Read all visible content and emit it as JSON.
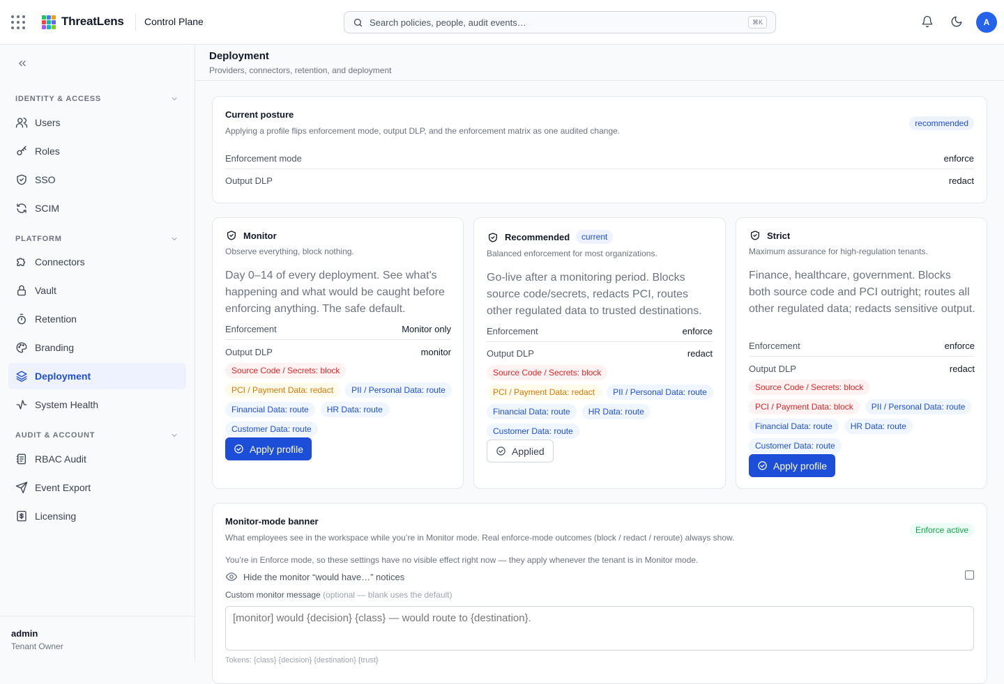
{
  "topbar": {
    "brand": "ThreatLens",
    "section": "Control Plane",
    "search_placeholder": "Search policies, people, audit events…",
    "search_shortcut": "⌘K",
    "avatar_initial": "A",
    "logo_colors": [
      "#22c55e",
      "#3b82f6",
      "#f59e0b",
      "#ef4444",
      "#14b8a6",
      "#6366f1",
      "#a855f7",
      "#06b6d4",
      "#84cc16"
    ]
  },
  "sidebar": {
    "sections": [
      {
        "title": "IDENTITY & ACCESS",
        "items": [
          {
            "label": "Users",
            "icon": "users-icon"
          },
          {
            "label": "Roles",
            "icon": "key-icon"
          },
          {
            "label": "SSO",
            "icon": "shield-icon"
          },
          {
            "label": "SCIM",
            "icon": "refresh-icon"
          }
        ]
      },
      {
        "title": "PLATFORM",
        "items": [
          {
            "label": "Connectors",
            "icon": "puzzle-icon"
          },
          {
            "label": "Vault",
            "icon": "lock-icon"
          },
          {
            "label": "Retention",
            "icon": "timer-icon"
          },
          {
            "label": "Branding",
            "icon": "palette-icon"
          },
          {
            "label": "Deployment",
            "icon": "layers-icon",
            "active": true
          },
          {
            "label": "System Health",
            "icon": "activity-icon"
          }
        ]
      },
      {
        "title": "AUDIT & ACCOUNT",
        "items": [
          {
            "label": "RBAC Audit",
            "icon": "audit-log-icon"
          },
          {
            "label": "Event Export",
            "icon": "send-icon"
          },
          {
            "label": "Licensing",
            "icon": "license-icon"
          }
        ]
      }
    ],
    "user": {
      "name": "admin",
      "role": "Tenant Owner"
    }
  },
  "page": {
    "title": "Deployment",
    "subtitle": "Providers, connectors, retention, and deployment"
  },
  "posture": {
    "title": "Current posture",
    "subtitle": "Applying a profile flips enforcement mode, output DLP, and the enforcement matrix as one audited change.",
    "badge": "recommended",
    "rows": [
      {
        "key": "Enforcement mode",
        "value": "enforce"
      },
      {
        "key": "Output DLP",
        "value": "redact"
      }
    ]
  },
  "profiles": [
    {
      "title": "Monitor",
      "badge": "",
      "subtitle": "Observe everything, block nothing.",
      "description": "Day 0–14 of every deployment. See what's happening and what would be caught before enforcing anything. The safe default.",
      "enforcement_label": "Enforcement",
      "enforcement": "Monitor only",
      "dlp_label": "Output DLP",
      "dlp": "monitor",
      "chips": [
        {
          "text": "Source Code / Secrets: block",
          "kind": "block"
        },
        {
          "text": "PCI / Payment Data: redact",
          "kind": "redact"
        },
        {
          "text": "PII / Personal Data: route",
          "kind": "route"
        },
        {
          "text": "Financial Data: route",
          "kind": "route"
        },
        {
          "text": "HR Data: route",
          "kind": "route"
        },
        {
          "text": "Customer Data: route",
          "kind": "route"
        }
      ],
      "button": "Apply profile",
      "button_kind": "primary"
    },
    {
      "title": "Recommended",
      "badge": "current",
      "subtitle": "Balanced enforcement for most organizations.",
      "description": "Go-live after a monitoring period. Blocks source code/secrets, redacts PCI, routes other regulated data to trusted destinations.",
      "enforcement_label": "Enforcement",
      "enforcement": "enforce",
      "dlp_label": "Output DLP",
      "dlp": "redact",
      "chips": [
        {
          "text": "Source Code / Secrets: block",
          "kind": "block"
        },
        {
          "text": "PCI / Payment Data: redact",
          "kind": "redact"
        },
        {
          "text": "PII / Personal Data: route",
          "kind": "route"
        },
        {
          "text": "Financial Data: route",
          "kind": "route"
        },
        {
          "text": "HR Data: route",
          "kind": "route"
        },
        {
          "text": "Customer Data: route",
          "kind": "route"
        }
      ],
      "button": "Applied",
      "button_kind": "ghost"
    },
    {
      "title": "Strict",
      "badge": "",
      "subtitle": "Maximum assurance for high-regulation tenants.",
      "description": "Finance, healthcare, government. Blocks both source code and PCI outright; routes all other regulated data; redacts sensitive output.",
      "enforcement_label": "Enforcement",
      "enforcement": "enforce",
      "dlp_label": "Output DLP",
      "dlp": "redact",
      "chips": [
        {
          "text": "Source Code / Secrets: block",
          "kind": "block"
        },
        {
          "text": "PCI / Payment Data: block",
          "kind": "block"
        },
        {
          "text": "PII / Personal Data: route",
          "kind": "route"
        },
        {
          "text": "Financial Data: route",
          "kind": "route"
        },
        {
          "text": "HR Data: route",
          "kind": "route"
        },
        {
          "text": "Customer Data: route",
          "kind": "route"
        }
      ],
      "button": "Apply profile",
      "button_kind": "primary"
    }
  ],
  "banner": {
    "title": "Monitor-mode banner",
    "subtitle": "What employees see in the workspace while you’re in Monitor mode. Real enforce-mode outcomes (block / redact / reroute) always show.",
    "badge": "Enforce active",
    "note": "You’re in Enforce mode, so these settings have no visible effect right now — they apply whenever the tenant is in Monitor mode.",
    "hide_label": "Hide the monitor “would have…” notices",
    "hide_checked": false,
    "message_label": "Custom monitor message",
    "message_hint": "(optional — blank uses the default)",
    "message_placeholder": "[monitor] would {decision} {class} — would route to {destination}.",
    "tokens": "Tokens: {class} {decision} {destination} {trust}"
  }
}
